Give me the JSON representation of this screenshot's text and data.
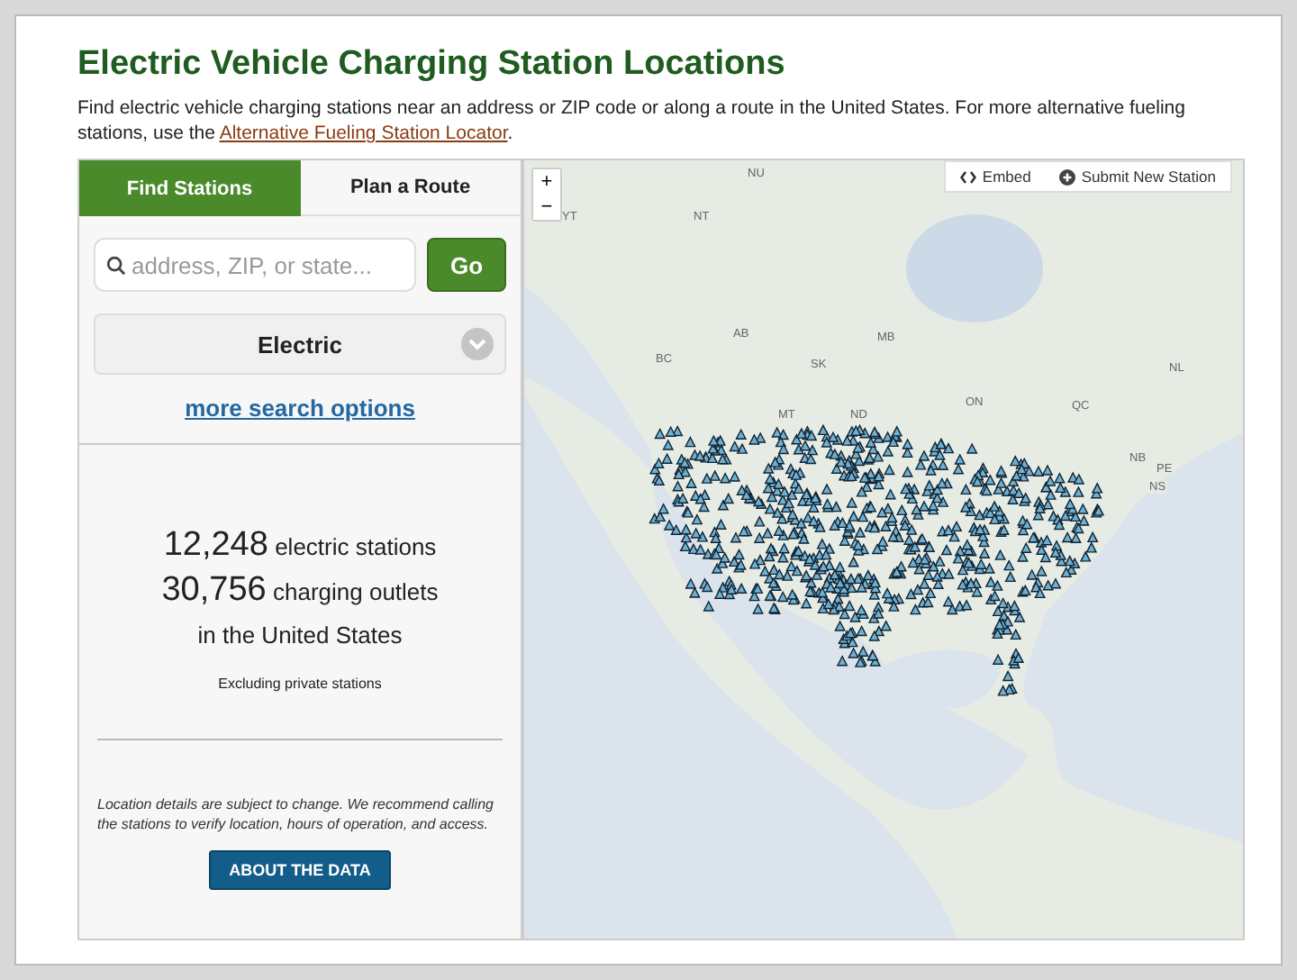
{
  "header": {
    "title": "Electric Vehicle Charging Station Locations",
    "intro_before": "Find electric vehicle charging stations near an address or ZIP code or along a route in the United States. For more alternative fueling stations, use the ",
    "intro_link": "Alternative Fueling Station Locator",
    "intro_after": "."
  },
  "tabs": [
    {
      "label": "Find Stations",
      "selected": true
    },
    {
      "label": "Plan a Route",
      "selected": false
    }
  ],
  "search": {
    "placeholder": "address, ZIP, or state...",
    "button": "Go"
  },
  "fuel_select": {
    "value": "Electric"
  },
  "more_options": "more search options",
  "stats": {
    "stations_count": "12,248",
    "stations_label": "electric stations",
    "outlets_count": "30,756",
    "outlets_label": "charging outlets",
    "region": "in the United States",
    "note": "Excluding private stations"
  },
  "disclaimer": "Location details are subject to change. We recommend calling the stations to verify location, hours of operation, and access.",
  "about_button": "ABOUT THE DATA",
  "map": {
    "zoom_in": "+",
    "zoom_out": "−",
    "embed": "Embed",
    "submit": "Submit New Station",
    "labels": [
      "NU",
      "YT",
      "NT",
      "AB",
      "MB",
      "BC",
      "SK",
      "NL",
      "ON",
      "QC",
      "MT",
      "ND",
      "NB",
      "PE",
      "NS"
    ]
  }
}
